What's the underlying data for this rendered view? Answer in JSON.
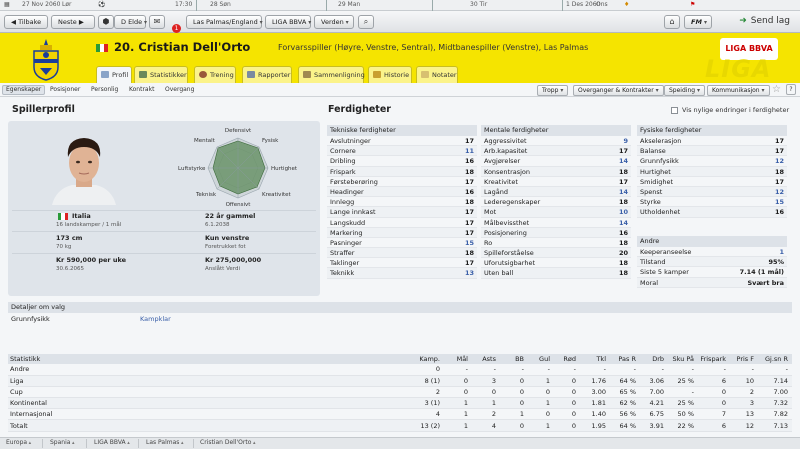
{
  "timeline": {
    "current": "27 Nov 2060",
    "current_day": "Lør",
    "time": "17:30",
    "events": [
      {
        "label": "28 Søn"
      },
      {
        "label": "29 Man"
      },
      {
        "label": "30 Tir"
      },
      {
        "label": "1 Des 2060",
        "day": "Ons"
      }
    ]
  },
  "toolbar": {
    "back": "Tilbake",
    "next": "Neste",
    "manager": "D Elde",
    "notif_count": "1",
    "nation_menu": "Las Palmas/England",
    "league_menu": "LIGA BBVA",
    "world_menu": "Verden",
    "fm_menu": "FM",
    "send_label": "Send lag"
  },
  "header": {
    "number_name": "20. Cristian Dell'Orto",
    "positions": "Forvarsspiller (Høyre, Venstre, Sentral), Midtbanespiller (Venstre), Las Palmas",
    "league_logo": "LIGA BBVA",
    "watermark": "LIGA"
  },
  "main_tabs": [
    "Profil",
    "Statistikker",
    "Trening",
    "Rapporter",
    "Sammenligning",
    "Historie",
    "Notater"
  ],
  "sub_tabs": [
    "Egenskaper",
    "Posisjoner",
    "Personlig",
    "Kontrakt",
    "Overgang"
  ],
  "action_buttons": [
    "Tropp",
    "Overganger & Kontrakter",
    "Speiding",
    "Kommunikasjon"
  ],
  "profile": {
    "section_title": "Spillerprofil",
    "radar_labels": [
      "Defensivt",
      "Fysisk",
      "Hurtighet",
      "Kreativitet",
      "Offensivt",
      "Teknisk",
      "Luftstyrke",
      "Mentalt"
    ],
    "nationality": "Italia",
    "caps": "16 landskamper / 1 mål",
    "age": "22 år gammel",
    "dob": "6.1.2038",
    "height": "173 cm",
    "weight": "70 kg",
    "foot": "Kun venstre",
    "foot_label": "Foretrukket fot",
    "wage": "Kr 590,000 per uke",
    "contract_end": "30.6.2065",
    "value": "Kr 275,000,000",
    "value_label": "Anslått Verdi"
  },
  "abilities": {
    "section_title": "Ferdigheter",
    "recent_changes": "Vis nylige endringer i ferdigheter",
    "technical": {
      "title": "Tekniske ferdigheter",
      "rows": [
        [
          "Avslutninger",
          "17"
        ],
        [
          "Cornere",
          "11"
        ],
        [
          "Dribling",
          "16"
        ],
        [
          "Frispark",
          "18"
        ],
        [
          "Førsteberøring",
          "17"
        ],
        [
          "Headinger",
          "16"
        ],
        [
          "Innlegg",
          "18"
        ],
        [
          "Lange innkast",
          "17"
        ],
        [
          "Langskudd",
          "17"
        ],
        [
          "Markering",
          "17"
        ],
        [
          "Pasninger",
          "15"
        ],
        [
          "Straffer",
          "18"
        ],
        [
          "Taklinger",
          "17"
        ],
        [
          "Teknikk",
          "13"
        ]
      ]
    },
    "mental": {
      "title": "Mentale ferdigheter",
      "rows": [
        [
          "Aggressivitet",
          "9"
        ],
        [
          "Arb.kapasitet",
          "17"
        ],
        [
          "Avgjørelser",
          "14"
        ],
        [
          "Konsentrasjon",
          "18"
        ],
        [
          "Kreativitet",
          "17"
        ],
        [
          "Lagånd",
          "14"
        ],
        [
          "Lederegenskaper",
          "18"
        ],
        [
          "Mot",
          "10"
        ],
        [
          "Målbevissthet",
          "14"
        ],
        [
          "Posisjonering",
          "16"
        ],
        [
          "Ro",
          "18"
        ],
        [
          "Spilleforståelse",
          "20"
        ],
        [
          "Uforutsigbarhet",
          "18"
        ],
        [
          "Uten ball",
          "18"
        ]
      ]
    },
    "physical": {
      "title": "Fysiske ferdigheter",
      "rows": [
        [
          "Akselerasjon",
          "17"
        ],
        [
          "Balanse",
          "17"
        ],
        [
          "Grunnfysikk",
          "12"
        ],
        [
          "Hurtighet",
          "18"
        ],
        [
          "Smidighet",
          "17"
        ],
        [
          "Spenst",
          "12"
        ],
        [
          "Styrke",
          "15"
        ],
        [
          "Utholdenhet",
          "16"
        ]
      ]
    },
    "other": {
      "title": "Andre",
      "rows": [
        [
          "Keeperanseelse",
          "1"
        ],
        [
          "Tilstand",
          "95%"
        ],
        [
          "Siste 5 kamper",
          "7.14 (1 mål)"
        ],
        [
          "Moral",
          "Svært bra"
        ]
      ]
    }
  },
  "details": {
    "title": "Detaljer om valg",
    "label": "Grunnfysikk",
    "value": "Kampklar"
  },
  "stats": {
    "headers": [
      "Statistikk",
      "Kamp.",
      "Mål",
      "Asts",
      "BB",
      "Gul",
      "Rød",
      "Tkl",
      "Pas R",
      "Drb",
      "Sku På",
      "Frispark",
      "Pris F",
      "Gj.sn R"
    ],
    "rows": [
      [
        "Andre",
        "0",
        "-",
        "-",
        "-",
        "-",
        "-",
        "-",
        "-",
        "-",
        "-",
        "-",
        "-",
        "-"
      ],
      [
        "Liga",
        "8 (1)",
        "0",
        "3",
        "0",
        "1",
        "0",
        "1.76",
        "64 %",
        "3.06",
        "25 %",
        "6",
        "10",
        "7.14"
      ],
      [
        "Cup",
        "2",
        "0",
        "0",
        "0",
        "0",
        "0",
        "3.00",
        "65 %",
        "7.00",
        "-",
        "0",
        "2",
        "7.00"
      ],
      [
        "Kontinental",
        "3 (1)",
        "1",
        "1",
        "0",
        "1",
        "0",
        "1.81",
        "62 %",
        "4.21",
        "25 %",
        "0",
        "3",
        "7.32"
      ],
      [
        "Internasjonal",
        "4",
        "1",
        "2",
        "1",
        "0",
        "0",
        "1.40",
        "56 %",
        "6.75",
        "50 %",
        "7",
        "13",
        "7.82"
      ],
      [
        "Totalt",
        "13 (2)",
        "1",
        "4",
        "0",
        "1",
        "0",
        "1.95",
        "64 %",
        "3.91",
        "22 %",
        "6",
        "12",
        "7.13"
      ]
    ]
  },
  "breadcrumb": [
    "Europa",
    "Spania",
    "LIGA BBVA",
    "Las Palmas",
    "Cristian Dell'Orto"
  ],
  "colors": {
    "header": "#f5e400",
    "tab": "#fbf38a",
    "panel": "#f4f6f8",
    "accent_value": "#3a5fa8"
  }
}
